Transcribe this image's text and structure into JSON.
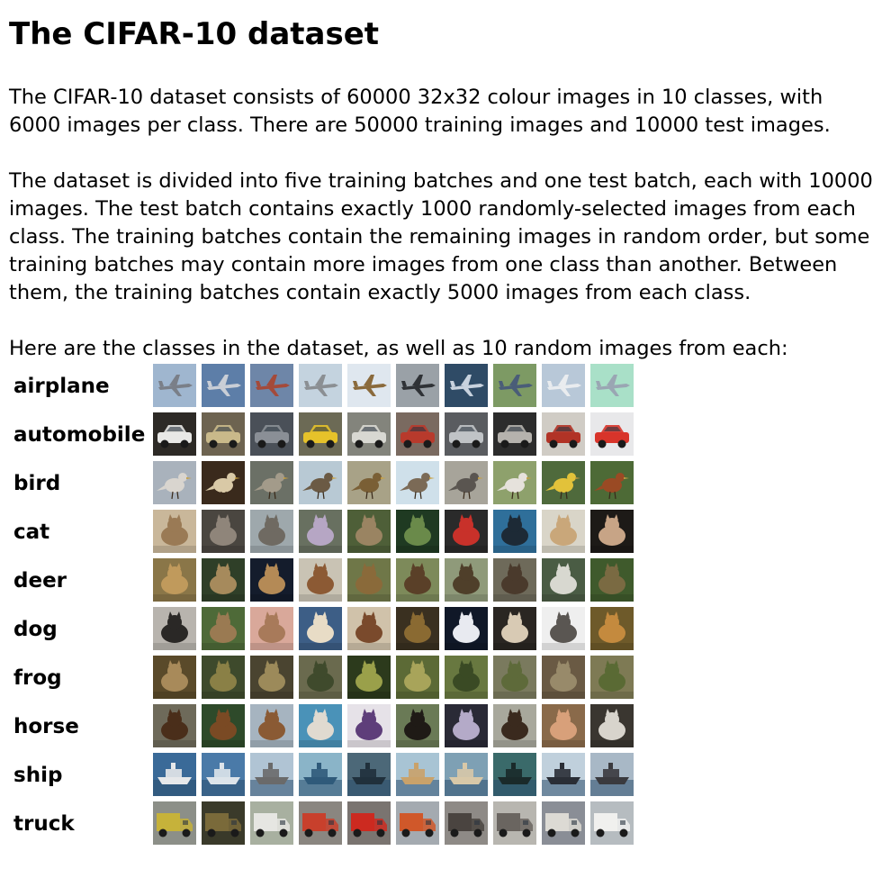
{
  "title": "The CIFAR-10 dataset",
  "paragraphs": {
    "intro": "The CIFAR-10 dataset consists of 60000 32x32 colour images in 10 classes, with 6000 images per class. There are 50000 training images and 10000 test images.",
    "batches": "The dataset is divided into five training batches and one test batch, each with 10000 images. The test batch contains exactly 1000 randomly-selected images from each class. The training batches contain the remaining images in random order, but some training batches may contain more images from one class than another. Between them, the training batches contain exactly 5000 images from each class.",
    "classes_intro": "Here are the classes in the dataset, as well as 10 random images from each:"
  },
  "classes": [
    {
      "name": "airplane",
      "thumbs": [
        {
          "bg": "#9fb6cf",
          "fg": "#7a7f88",
          "shape": "plane"
        },
        {
          "bg": "#5d7ea8",
          "fg": "#c9ced6",
          "shape": "plane"
        },
        {
          "bg": "#6e86a8",
          "fg": "#a44a3a",
          "shape": "plane"
        },
        {
          "bg": "#c4d3df",
          "fg": "#8b8f93",
          "shape": "plane"
        },
        {
          "bg": "#dfe7ef",
          "fg": "#8a6a3c",
          "shape": "plane"
        },
        {
          "bg": "#9aa1a7",
          "fg": "#2f3236",
          "shape": "plane"
        },
        {
          "bg": "#2f4b66",
          "fg": "#c8d2de",
          "shape": "plane"
        },
        {
          "bg": "#7d9a64",
          "fg": "#4a5d78",
          "shape": "plane"
        },
        {
          "bg": "#b8c8d8",
          "fg": "#e9ecef",
          "shape": "plane"
        },
        {
          "bg": "#a9e0c8",
          "fg": "#9aa6b3",
          "shape": "plane"
        }
      ]
    },
    {
      "name": "automobile",
      "thumbs": [
        {
          "bg": "#2d2a26",
          "fg": "#e8e8e6",
          "shape": "car"
        },
        {
          "bg": "#6d6350",
          "fg": "#c9b98a",
          "shape": "car"
        },
        {
          "bg": "#4a5058",
          "fg": "#8a8f96",
          "shape": "car"
        },
        {
          "bg": "#6c6a55",
          "fg": "#e6c22a",
          "shape": "car"
        },
        {
          "bg": "#83847c",
          "fg": "#d8d8d2",
          "shape": "car"
        },
        {
          "bg": "#7a6a60",
          "fg": "#b83a2c",
          "shape": "car"
        },
        {
          "bg": "#5a5c60",
          "fg": "#c0c3c6",
          "shape": "car"
        },
        {
          "bg": "#2c2c2c",
          "fg": "#b5b2ad",
          "shape": "car"
        },
        {
          "bg": "#d0ccc5",
          "fg": "#b13326",
          "shape": "car"
        },
        {
          "bg": "#e8e8ea",
          "fg": "#d8342a",
          "shape": "car"
        }
      ]
    },
    {
      "name": "bird",
      "thumbs": [
        {
          "bg": "#a9b2bc",
          "fg": "#d9d5cf",
          "shape": "bird"
        },
        {
          "bg": "#3a2a1c",
          "fg": "#d9c9a6",
          "shape": "bird"
        },
        {
          "bg": "#6b7066",
          "fg": "#a39b8a",
          "shape": "bird"
        },
        {
          "bg": "#b8c9d4",
          "fg": "#6b5a44",
          "shape": "bird"
        },
        {
          "bg": "#a8a287",
          "fg": "#7a5f35",
          "shape": "bird"
        },
        {
          "bg": "#cfe0ea",
          "fg": "#7b6a56",
          "shape": "bird"
        },
        {
          "bg": "#a7a49a",
          "fg": "#5a5550",
          "shape": "bird"
        },
        {
          "bg": "#8ea16c",
          "fg": "#e6e2dc",
          "shape": "bird"
        },
        {
          "bg": "#4f6a3c",
          "fg": "#e2c23a",
          "shape": "bird"
        },
        {
          "bg": "#4d6a36",
          "fg": "#9a4a24",
          "shape": "bird"
        }
      ]
    },
    {
      "name": "cat",
      "thumbs": [
        {
          "bg": "#c9b79a",
          "fg": "#9a7a55",
          "shape": "animal"
        },
        {
          "bg": "#4a4640",
          "fg": "#8f857a",
          "shape": "animal"
        },
        {
          "bg": "#9ea8ac",
          "fg": "#6f6a62",
          "shape": "animal"
        },
        {
          "bg": "#687060",
          "fg": "#b6a6c4",
          "shape": "animal"
        },
        {
          "bg": "#4e5f38",
          "fg": "#9a8462",
          "shape": "animal"
        },
        {
          "bg": "#1f3a22",
          "fg": "#6a8a4a",
          "shape": "animal"
        },
        {
          "bg": "#2a2a2a",
          "fg": "#c8312a",
          "shape": "animal"
        },
        {
          "bg": "#2f6f9a",
          "fg": "#1d2a36",
          "shape": "animal"
        },
        {
          "bg": "#d9d5c8",
          "fg": "#c9a77a",
          "shape": "animal"
        },
        {
          "bg": "#1d1a17",
          "fg": "#c7a486",
          "shape": "animal"
        }
      ]
    },
    {
      "name": "deer",
      "thumbs": [
        {
          "bg": "#8a7648",
          "fg": "#c09a5c",
          "shape": "animal"
        },
        {
          "bg": "#2f3f28",
          "fg": "#a68a5c",
          "shape": "animal"
        },
        {
          "bg": "#141c2c",
          "fg": "#b48a56",
          "shape": "animal"
        },
        {
          "bg": "#c9c3b4",
          "fg": "#8c5a34",
          "shape": "animal"
        },
        {
          "bg": "#6f7748",
          "fg": "#8a6a3a",
          "shape": "animal"
        },
        {
          "bg": "#7d8a5a",
          "fg": "#5a4028",
          "shape": "animal"
        },
        {
          "bg": "#8f9a7a",
          "fg": "#4f3f2a",
          "shape": "animal"
        },
        {
          "bg": "#6e6a5a",
          "fg": "#4a3a2c",
          "shape": "animal"
        },
        {
          "bg": "#4a5c44",
          "fg": "#d8d8d0",
          "shape": "animal"
        },
        {
          "bg": "#3f5a2c",
          "fg": "#7a6a42",
          "shape": "animal"
        }
      ]
    },
    {
      "name": "dog",
      "thumbs": [
        {
          "bg": "#b8b4ae",
          "fg": "#2a2826",
          "shape": "animal"
        },
        {
          "bg": "#4e6a38",
          "fg": "#9a7a52",
          "shape": "animal"
        },
        {
          "bg": "#d9a89a",
          "fg": "#a87a5a",
          "shape": "animal"
        },
        {
          "bg": "#3d5e86",
          "fg": "#e8dcc6",
          "shape": "animal"
        },
        {
          "bg": "#d0c2aa",
          "fg": "#7a4a2c",
          "shape": "animal"
        },
        {
          "bg": "#3a3020",
          "fg": "#8a6a32",
          "shape": "animal"
        },
        {
          "bg": "#101828",
          "fg": "#e8eaf0",
          "shape": "animal"
        },
        {
          "bg": "#2a2622",
          "fg": "#d8cab4",
          "shape": "animal"
        },
        {
          "bg": "#efefef",
          "fg": "#5a5652",
          "shape": "animal"
        },
        {
          "bg": "#6e5a2a",
          "fg": "#c48a3e",
          "shape": "animal"
        }
      ]
    },
    {
      "name": "frog",
      "thumbs": [
        {
          "bg": "#5a4a2a",
          "fg": "#a88a5a",
          "shape": "animal"
        },
        {
          "bg": "#3e4a2c",
          "fg": "#8a8046",
          "shape": "animal"
        },
        {
          "bg": "#4a4430",
          "fg": "#9c8a5a",
          "shape": "animal"
        },
        {
          "bg": "#6a6a4e",
          "fg": "#3f4a2c",
          "shape": "animal"
        },
        {
          "bg": "#2c3a1c",
          "fg": "#9aa04a",
          "shape": "animal"
        },
        {
          "bg": "#5c6a36",
          "fg": "#a8a45a",
          "shape": "animal"
        },
        {
          "bg": "#687840",
          "fg": "#3a4a24",
          "shape": "animal"
        },
        {
          "bg": "#7a7a5e",
          "fg": "#5e6a3a",
          "shape": "animal"
        },
        {
          "bg": "#6a5a44",
          "fg": "#988a6a",
          "shape": "animal"
        },
        {
          "bg": "#7e7a54",
          "fg": "#5a6a34",
          "shape": "animal"
        }
      ]
    },
    {
      "name": "horse",
      "thumbs": [
        {
          "bg": "#6e6a5a",
          "fg": "#4a2e1a",
          "shape": "animal"
        },
        {
          "bg": "#2e4a2a",
          "fg": "#7a4a24",
          "shape": "animal"
        },
        {
          "bg": "#a6b4c0",
          "fg": "#8a5a34",
          "shape": "animal"
        },
        {
          "bg": "#4a92b8",
          "fg": "#e0dad0",
          "shape": "animal"
        },
        {
          "bg": "#e6e2e8",
          "fg": "#5e3e7a",
          "shape": "animal"
        },
        {
          "bg": "#6a7a56",
          "fg": "#1f1a16",
          "shape": "animal"
        },
        {
          "bg": "#2a2a36",
          "fg": "#b4aac8",
          "shape": "animal"
        },
        {
          "bg": "#a8a89c",
          "fg": "#3a2a1e",
          "shape": "animal"
        },
        {
          "bg": "#8a6a4a",
          "fg": "#d8a07a",
          "shape": "animal"
        },
        {
          "bg": "#3a3630",
          "fg": "#d8d4cc",
          "shape": "animal"
        }
      ]
    },
    {
      "name": "ship",
      "thumbs": [
        {
          "bg": "#3a6a98",
          "fg": "#e6e8ea",
          "shape": "ship"
        },
        {
          "bg": "#4a7aa8",
          "fg": "#dde4ea",
          "shape": "ship"
        },
        {
          "bg": "#b0c4d4",
          "fg": "#6a6a6a",
          "shape": "ship"
        },
        {
          "bg": "#8ab4c8",
          "fg": "#2f5a7a",
          "shape": "ship"
        },
        {
          "bg": "#4c6878",
          "fg": "#20303c",
          "shape": "ship"
        },
        {
          "bg": "#a8c4d4",
          "fg": "#c9a26a",
          "shape": "ship"
        },
        {
          "bg": "#7ea0b4",
          "fg": "#d8c8a8",
          "shape": "ship"
        },
        {
          "bg": "#3a6a6a",
          "fg": "#1a2a2a",
          "shape": "ship"
        },
        {
          "bg": "#c0d0dc",
          "fg": "#2a2e36",
          "shape": "ship"
        },
        {
          "bg": "#a8b8c6",
          "fg": "#3a3a3e",
          "shape": "ship"
        }
      ]
    },
    {
      "name": "truck",
      "thumbs": [
        {
          "bg": "#8c8f88",
          "fg": "#c6b23a",
          "shape": "truck"
        },
        {
          "bg": "#3a3a2a",
          "fg": "#7a6a3a",
          "shape": "truck"
        },
        {
          "bg": "#a8b0a0",
          "fg": "#e6e6e2",
          "shape": "truck"
        },
        {
          "bg": "#8a8680",
          "fg": "#c8402c",
          "shape": "truck"
        },
        {
          "bg": "#7a7470",
          "fg": "#cc2a20",
          "shape": "truck"
        },
        {
          "bg": "#a4aab0",
          "fg": "#d0582a",
          "shape": "truck"
        },
        {
          "bg": "#8e8a86",
          "fg": "#4a4440",
          "shape": "truck"
        },
        {
          "bg": "#b8b6b0",
          "fg": "#6a6560",
          "shape": "truck"
        },
        {
          "bg": "#8a8e96",
          "fg": "#dcdad4",
          "shape": "truck"
        },
        {
          "bg": "#b6bcc0",
          "fg": "#f0f0ee",
          "shape": "truck"
        }
      ]
    }
  ]
}
